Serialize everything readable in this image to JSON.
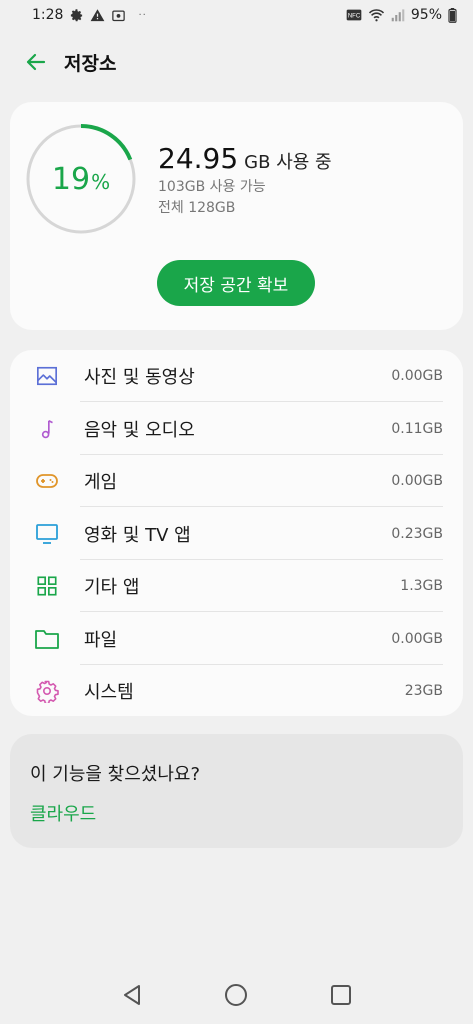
{
  "status_bar": {
    "time": "1:28",
    "battery": "95%",
    "dots": "··",
    "icons": [
      "gear-icon",
      "warning-icon",
      "screenshot-icon",
      "nfc-icon",
      "wifi-icon",
      "signal-icon"
    ]
  },
  "app_bar": {
    "title": "저장소",
    "back_icon": "back-arrow-icon"
  },
  "summary": {
    "percent_value": "19",
    "percent_sign": "%",
    "percent_fraction": 0.19,
    "used_value": "24.95",
    "used_unit": "GB 사용 중",
    "available": "103GB 사용 가능",
    "total": "전체 128GB",
    "free_button": "저장 공간 확보",
    "accent_color": "#1aa64a"
  },
  "categories": [
    {
      "label": "사진 및 동영상",
      "size": "0.00GB",
      "icon": "photo-icon",
      "color": "#5b6fd6"
    },
    {
      "label": "음악 및 오디오",
      "size": "0.11GB",
      "icon": "music-note-icon",
      "color": "#b05ad0"
    },
    {
      "label": "게임",
      "size": "0.00GB",
      "icon": "gamepad-icon",
      "color": "#e0952a"
    },
    {
      "label": "영화 및 TV 앱",
      "size": "0.23GB",
      "icon": "tv-icon",
      "color": "#2a9fd8"
    },
    {
      "label": "기타 앱",
      "size": "1.3GB",
      "icon": "apps-grid-icon",
      "color": "#1aa64a"
    },
    {
      "label": "파일",
      "size": "0.00GB",
      "icon": "folder-icon",
      "color": "#1aa64a"
    },
    {
      "label": "시스템",
      "size": "23GB",
      "icon": "gear-icon",
      "color": "#d45ab0"
    }
  ],
  "suggestion": {
    "title": "이 기능을 찾으셨나요?",
    "link": "클라우드"
  },
  "nav_bar": {
    "icons": [
      "back-triangle-icon",
      "home-circle-icon",
      "recents-square-icon"
    ]
  }
}
